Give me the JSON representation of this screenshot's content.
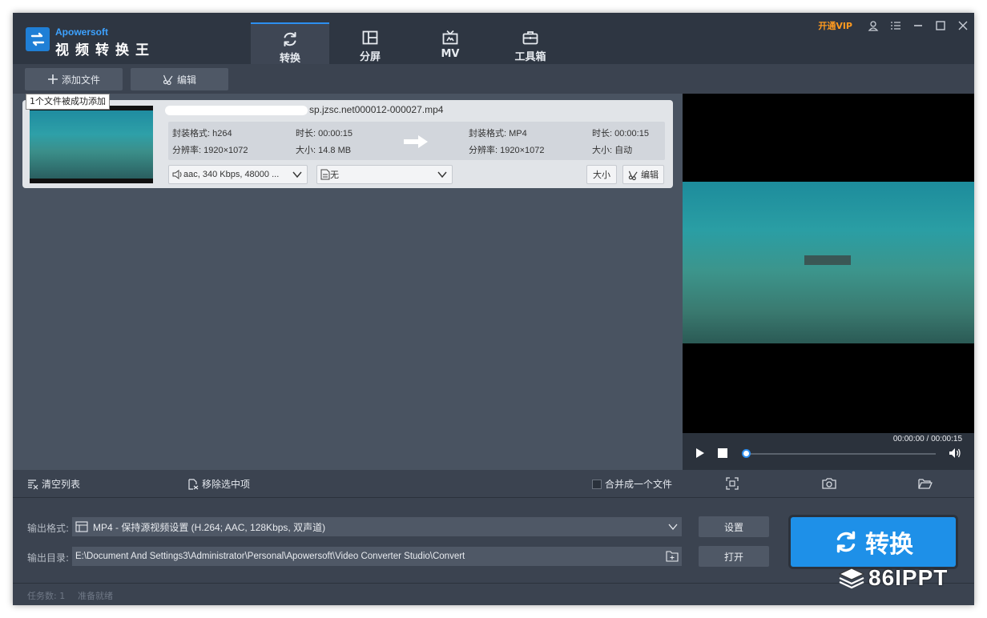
{
  "app": {
    "brand": "Apowersoft",
    "name": "视频转换王"
  },
  "tabs": [
    {
      "label": "转换",
      "icon": "refresh-icon",
      "active": true
    },
    {
      "label": "分屏",
      "icon": "split-screen-icon",
      "active": false
    },
    {
      "label": "MV",
      "icon": "tv-icon",
      "active": false
    },
    {
      "label": "工具箱",
      "icon": "toolbox-icon",
      "active": false
    }
  ],
  "window": {
    "vip_label": "开通VIP"
  },
  "toolbar": {
    "add_file_label": "添加文件",
    "edit_label": "编辑"
  },
  "tooltip": "1个文件被成功添加",
  "file": {
    "name": "sp.jzsc.net000012-000027.mp4",
    "source": {
      "format": "封装格式: h264",
      "resolution": "分辨率: 1920×1072",
      "duration": "时长: 00:00:15",
      "size": "大小: 14.8 MB"
    },
    "target": {
      "format": "封装格式: MP4",
      "resolution": "分辨率: 1920×1072",
      "duration": "时长: 00:00:15",
      "size": "大小: 自动"
    },
    "audio_track": "aac, 340 Kbps, 48000 ...",
    "subtitle": "无",
    "size_button": "大小",
    "edit_button": "编辑"
  },
  "player": {
    "time": "00:00:00 / 00:00:15",
    "progress": 0
  },
  "listbar": {
    "clear_label": "清空列表",
    "remove_label": "移除选中项",
    "merge_label": "合并成一个文件",
    "merge_checked": false
  },
  "output": {
    "format_label": "输出格式:",
    "format_value": "MP4 - 保持源视频设置 (H.264; AAC, 128Kbps, 双声道)",
    "dir_label": "输出目录:",
    "dir_value": "E:\\Document And Settings3\\Administrator\\Personal\\Apowersoft\\Video Converter Studio\\Convert",
    "settings_button": "设置",
    "open_button": "打开",
    "convert_button": "转换"
  },
  "status": {
    "task_count": "任务数: 1",
    "state": "准备就绪"
  },
  "watermark": "86IPPT",
  "colors": {
    "accent": "#1e90e8",
    "vip": "#ff9a1f",
    "titlebar": "#2e3642",
    "panel": "#495361"
  }
}
